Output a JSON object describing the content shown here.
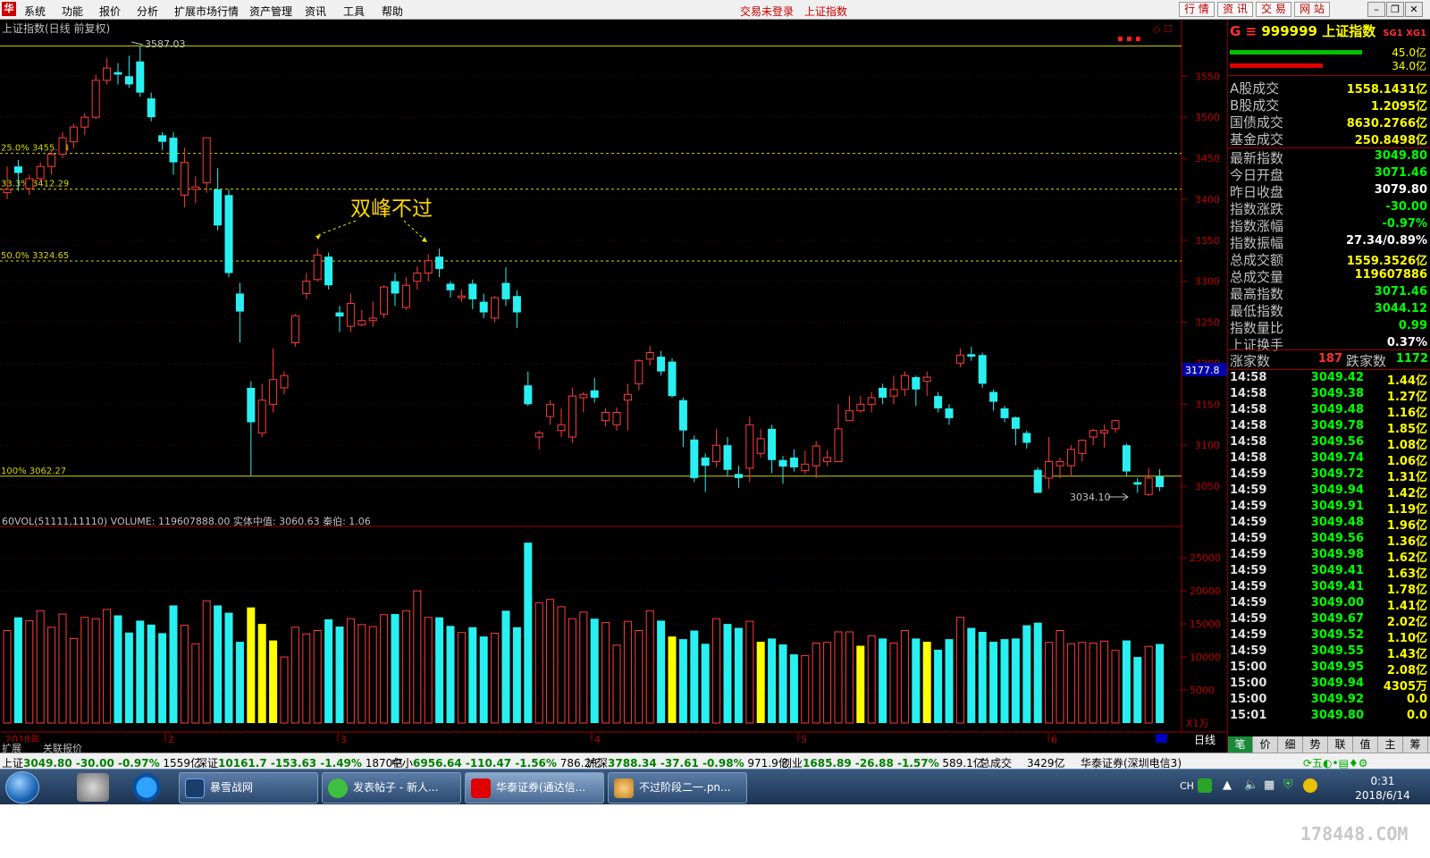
{
  "menu": {
    "items": [
      "系统",
      "功能",
      "报价",
      "分析",
      "扩展市场行情",
      "资产管理",
      "资讯",
      "工具",
      "帮助"
    ],
    "status_notice": "交易未登录",
    "status_index": "上证指数",
    "quick_buttons": [
      "行 情",
      "资 讯",
      "交 易",
      "网 站"
    ]
  },
  "chart": {
    "title": "上证指数(日线 前复权)",
    "annotation": "双峰不过",
    "high_label": "3587.03",
    "low_label": "3034.10",
    "crosshair_price": "3177.8",
    "volume_header": "60VOL(51111,11110)  VOLUME: 119607888.00  实体中值: 3060.63  秦伯: 1.06",
    "volume_unit": "X1万",
    "fib_levels": [
      {
        "label": "25.0% 3455.84",
        "price": 3455.84
      },
      {
        "label": "33.3% 3412.29",
        "price": 3412.29
      },
      {
        "label": "50.0% 3324.65",
        "price": 3324.65
      },
      {
        "label": "100% 3062.27",
        "price": 3062.27
      }
    ],
    "top_line_price": 3587.03,
    "date_labels": [
      "2018年",
      "2",
      "3",
      "4",
      "5",
      "6"
    ],
    "period_label": "日线",
    "bottom_tabs": [
      "扩展　　",
      "关联报价"
    ]
  },
  "chart_data": {
    "type": "candlestick",
    "price_axis": {
      "ticks": [
        3050,
        3100,
        3150,
        3200,
        3250,
        3300,
        3350,
        3400,
        3450,
        3500,
        3550
      ],
      "range": [
        3025,
        3595
      ]
    },
    "volume_axis": {
      "ticks": [
        5000,
        10000,
        15000,
        20000,
        25000
      ],
      "range": [
        0,
        28000
      ],
      "unit": "万"
    },
    "candles": [
      [
        3412,
        3408,
        3440,
        3400,
        "u",
        14000
      ],
      [
        3440,
        3432,
        3448,
        3410,
        "d",
        16000
      ],
      [
        3413,
        3425,
        3430,
        3405,
        "u",
        15500
      ],
      [
        3425,
        3440,
        3445,
        3420,
        "u",
        17000
      ],
      [
        3440,
        3455,
        3460,
        3430,
        "u",
        14500
      ],
      [
        3455,
        3475,
        3482,
        3450,
        "u",
        16500
      ],
      [
        3470,
        3488,
        3492,
        3462,
        "u",
        12800
      ],
      [
        3488,
        3500,
        3505,
        3478,
        "u",
        16000
      ],
      [
        3500,
        3545,
        3552,
        3498,
        "u",
        15800
      ],
      [
        3545,
        3560,
        3572,
        3540,
        "u",
        17200
      ],
      [
        3555,
        3552,
        3566,
        3540,
        "d",
        16300
      ],
      [
        3540,
        3550,
        3575,
        3536,
        "d",
        13700
      ],
      [
        3568,
        3530,
        3587,
        3525,
        "d",
        15500
      ],
      [
        3523,
        3500,
        3530,
        3495,
        "d",
        14900
      ],
      [
        3478,
        3470,
        3482,
        3460,
        "d",
        13600
      ],
      [
        3475,
        3445,
        3482,
        3430,
        "d",
        17800
      ],
      [
        3405,
        3445,
        3463,
        3390,
        "u",
        14800
      ],
      [
        3415,
        3412,
        3428,
        3395,
        "u",
        12000
      ],
      [
        3420,
        3475,
        3475,
        3408,
        "u",
        18500
      ],
      [
        3412,
        3368,
        3438,
        3362,
        "d",
        17800
      ],
      [
        3405,
        3310,
        3412,
        3305,
        "d",
        16700
      ],
      [
        3285,
        3263,
        3298,
        3225,
        "d",
        12300
      ],
      [
        3170,
        3128,
        3178,
        3063,
        "d",
        17500
      ],
      [
        3115,
        3155,
        3175,
        3110,
        "u",
        15000
      ],
      [
        3150,
        3180,
        3218,
        3140,
        "u",
        12500
      ],
      [
        3170,
        3185,
        3190,
        3162,
        "u",
        10000
      ],
      [
        3225,
        3258,
        3260,
        3220,
        "u",
        14500
      ],
      [
        3285,
        3300,
        3310,
        3278,
        "u",
        13500
      ],
      [
        3302,
        3332,
        3340,
        3300,
        "u",
        14000
      ],
      [
        3330,
        3295,
        3335,
        3290,
        "d",
        15700
      ],
      [
        3262,
        3257,
        3270,
        3238,
        "d",
        14600
      ],
      [
        3245,
        3273,
        3285,
        3238,
        "u",
        15800
      ],
      [
        3247,
        3252,
        3265,
        3245,
        "u",
        14900
      ],
      [
        3252,
        3255,
        3275,
        3244,
        "u",
        14600
      ],
      [
        3260,
        3293,
        3295,
        3255,
        "u",
        16400
      ],
      [
        3300,
        3285,
        3310,
        3270,
        "d",
        16500
      ],
      [
        3268,
        3295,
        3305,
        3265,
        "u",
        17000
      ],
      [
        3300,
        3310,
        3318,
        3290,
        "u",
        20000
      ],
      [
        3310,
        3325,
        3333,
        3300,
        "u",
        16000
      ],
      [
        3330,
        3315,
        3340,
        3305,
        "d",
        16000
      ],
      [
        3297,
        3289,
        3300,
        3280,
        "d",
        14700
      ],
      [
        3280,
        3282,
        3290,
        3275,
        "u",
        13700
      ],
      [
        3297,
        3278,
        3302,
        3266,
        "d",
        14500
      ],
      [
        3275,
        3262,
        3285,
        3255,
        "d",
        13100
      ],
      [
        3255,
        3280,
        3282,
        3250,
        "u",
        13600
      ],
      [
        3298,
        3278,
        3317,
        3270,
        "d",
        17000
      ],
      [
        3282,
        3262,
        3289,
        3243,
        "d",
        14500
      ],
      [
        3173,
        3150,
        3190,
        3148,
        "d",
        27300
      ],
      [
        3110,
        3115,
        3118,
        3095,
        "u",
        18200
      ],
      [
        3135,
        3150,
        3155,
        3125,
        "u",
        18700
      ],
      [
        3125,
        3118,
        3145,
        3110,
        "u",
        17600
      ],
      [
        3110,
        3160,
        3170,
        3103,
        "u",
        15800
      ],
      [
        3158,
        3162,
        3165,
        3140,
        "u",
        16800
      ],
      [
        3167,
        3158,
        3182,
        3152,
        "d",
        15800
      ],
      [
        3130,
        3140,
        3145,
        3123,
        "u",
        15200
      ],
      [
        3125,
        3140,
        3146,
        3118,
        "u",
        11800
      ],
      [
        3155,
        3162,
        3175,
        3118,
        "u",
        15400
      ],
      [
        3175,
        3203,
        3205,
        3167,
        "u",
        14000
      ],
      [
        3205,
        3213,
        3221,
        3197,
        "u",
        17000
      ],
      [
        3208,
        3190,
        3215,
        3185,
        "d",
        15500
      ],
      [
        3202,
        3160,
        3206,
        3158,
        "d",
        13100
      ],
      [
        3155,
        3118,
        3158,
        3098,
        "d",
        12700
      ],
      [
        3107,
        3060,
        3112,
        3055,
        "d",
        14000
      ],
      [
        3085,
        3075,
        3090,
        3043,
        "d",
        12000
      ],
      [
        3080,
        3100,
        3120,
        3073,
        "u",
        15800
      ],
      [
        3100,
        3070,
        3110,
        3062,
        "d",
        15000
      ],
      [
        3065,
        3060,
        3075,
        3048,
        "d",
        14400
      ],
      [
        3072,
        3125,
        3135,
        3055,
        "u",
        15400
      ],
      [
        3090,
        3108,
        3120,
        3085,
        "u",
        12300
      ],
      [
        3120,
        3082,
        3125,
        3066,
        "d",
        12800
      ],
      [
        3082,
        3074,
        3087,
        3053,
        "d",
        11900
      ],
      [
        3085,
        3073,
        3095,
        3068,
        "d",
        10400
      ],
      [
        3069,
        3077,
        3093,
        3065,
        "u",
        10200
      ],
      [
        3075,
        3099,
        3105,
        3060,
        "u",
        12100
      ],
      [
        3080,
        3085,
        3094,
        3075,
        "u",
        12200
      ],
      [
        3080,
        3120,
        3150,
        3080,
        "u",
        13800
      ],
      [
        3130,
        3142,
        3160,
        3130,
        "u",
        13800
      ],
      [
        3142,
        3150,
        3160,
        3140,
        "u",
        11700
      ],
      [
        3150,
        3158,
        3165,
        3140,
        "u",
        13200
      ],
      [
        3170,
        3158,
        3175,
        3150,
        "d",
        12800
      ],
      [
        3160,
        3168,
        3185,
        3150,
        "u",
        12100
      ],
      [
        3168,
        3185,
        3190,
        3160,
        "u",
        14000
      ],
      [
        3183,
        3168,
        3185,
        3148,
        "d",
        12800
      ],
      [
        3178,
        3183,
        3190,
        3160,
        "u",
        12300
      ],
      [
        3160,
        3145,
        3165,
        3140,
        "d",
        11100
      ],
      [
        3145,
        3133,
        3150,
        3125,
        "d",
        12700
      ],
      [
        3200,
        3210,
        3218,
        3195,
        "u",
        16000
      ],
      [
        3211,
        3208,
        3220,
        3203,
        "d",
        14400
      ],
      [
        3210,
        3175,
        3213,
        3170,
        "d",
        13800
      ],
      [
        3165,
        3153,
        3168,
        3142,
        "d",
        12300
      ],
      [
        3145,
        3133,
        3148,
        3128,
        "d",
        12700
      ],
      [
        3134,
        3120,
        3135,
        3100,
        "d",
        12800
      ],
      [
        3115,
        3103,
        3118,
        3096,
        "d",
        14800
      ],
      [
        3070,
        3042,
        3073,
        3042,
        "d",
        15200
      ],
      [
        3060,
        3080,
        3110,
        3047,
        "u",
        12200
      ],
      [
        3075,
        3080,
        3085,
        3060,
        "u",
        14000
      ],
      [
        3075,
        3095,
        3100,
        3062,
        "u",
        12000
      ],
      [
        3090,
        3106,
        3107,
        3080,
        "u",
        12200
      ],
      [
        3110,
        3118,
        3120,
        3100,
        "u",
        12100
      ],
      [
        3115,
        3118,
        3125,
        3097,
        "u",
        12400
      ],
      [
        3120,
        3130,
        3131,
        3115,
        "u",
        11000
      ],
      [
        3100,
        3068,
        3102,
        3062,
        "d",
        12500
      ],
      [
        3055,
        3052,
        3060,
        3042,
        "d",
        10000
      ],
      [
        3040,
        3060,
        3072,
        3038,
        "u",
        11600
      ],
      [
        3062,
        3049,
        3071,
        3044,
        "d",
        11961
      ]
    ],
    "yellow_volume_bars": [
      22,
      23,
      24,
      60,
      68,
      77,
      83
    ]
  },
  "right_panel": {
    "code": "999999",
    "name": "上证指数",
    "tag": "SG1 XG1",
    "bar_values": [
      "45.0亿",
      "34.0亿"
    ],
    "bar_ratio": [
      0.82,
      0.58
    ],
    "stats_a": [
      {
        "label": "A股成交",
        "value": "1558.1431亿"
      },
      {
        "label": "B股成交",
        "value": "1.2095亿"
      },
      {
        "label": "国债成交",
        "value": "8630.2766亿"
      },
      {
        "label": "基金成交",
        "value": "250.8498亿"
      }
    ],
    "stats_b": [
      {
        "label": "最新指数",
        "value": "3049.80",
        "color": "#00ff00"
      },
      {
        "label": "今日开盘",
        "value": "3071.46",
        "color": "#00ff00"
      },
      {
        "label": "昨日收盘",
        "value": "3079.80",
        "color": "#ffffff"
      },
      {
        "label": "指数涨跌",
        "value": "-30.00",
        "color": "#00ff00"
      },
      {
        "label": "指数涨幅",
        "value": "-0.97%",
        "color": "#00ff00"
      },
      {
        "label": "指数振幅",
        "value": "27.34/0.89%",
        "color": "#ffffff"
      },
      {
        "label": "总成交额",
        "value": "1559.3526亿",
        "color": "#ffff00"
      },
      {
        "label": "总成交量",
        "value": "119607886",
        "color": "#ffff00"
      },
      {
        "label": "最高指数",
        "value": "3071.46",
        "color": "#00ff00"
      },
      {
        "label": "最低指数",
        "value": "3044.12",
        "color": "#00ff00"
      },
      {
        "label": "指数量比",
        "value": "0.99",
        "color": "#00ff00"
      },
      {
        "label": "上证换手",
        "value": "0.37%",
        "color": "#ffffff"
      }
    ],
    "up_label": "涨家数",
    "up_count": "187",
    "down_label": "跌家数",
    "down_count": "1172",
    "trades": [
      [
        "14:58",
        "3049.42",
        "1.44亿"
      ],
      [
        "14:58",
        "3049.38",
        "1.27亿"
      ],
      [
        "14:58",
        "3049.48",
        "1.16亿"
      ],
      [
        "14:58",
        "3049.78",
        "1.85亿"
      ],
      [
        "14:58",
        "3049.56",
        "1.08亿"
      ],
      [
        "14:58",
        "3049.74",
        "1.06亿"
      ],
      [
        "14:59",
        "3049.72",
        "1.31亿"
      ],
      [
        "14:59",
        "3049.94",
        "1.42亿"
      ],
      [
        "14:59",
        "3049.91",
        "1.19亿"
      ],
      [
        "14:59",
        "3049.48",
        "1.96亿"
      ],
      [
        "14:59",
        "3049.56",
        "1.36亿"
      ],
      [
        "14:59",
        "3049.98",
        "1.62亿"
      ],
      [
        "14:59",
        "3049.41",
        "1.63亿"
      ],
      [
        "14:59",
        "3049.41",
        "1.78亿"
      ],
      [
        "14:59",
        "3049.00",
        "1.41亿"
      ],
      [
        "14:59",
        "3049.67",
        "2.02亿"
      ],
      [
        "14:59",
        "3049.52",
        "1.10亿"
      ],
      [
        "14:59",
        "3049.55",
        "1.43亿"
      ],
      [
        "15:00",
        "3049.95",
        "2.08亿"
      ],
      [
        "15:00",
        "3049.94",
        "4305万"
      ],
      [
        "15:00",
        "3049.92",
        "0.0"
      ],
      [
        "15:01",
        "3049.80",
        "0.0"
      ]
    ],
    "tabs": [
      "笔",
      "价",
      "细",
      "势",
      "联",
      "值",
      "主",
      "筹"
    ]
  },
  "bottom_bar": {
    "segments": [
      {
        "name": "上证",
        "value": "3049.80",
        "change": "-30.00",
        "pct": "-0.97%",
        "amount": "1559亿"
      },
      {
        "name": "深证",
        "value": "10161.7",
        "change": "-153.63",
        "pct": "-1.49%",
        "amount": "1870亿"
      },
      {
        "name": "中小",
        "value": "6956.64",
        "change": "-110.47",
        "pct": "-1.56%",
        "amount": "786.2亿"
      },
      {
        "name": "沪深",
        "value": "3788.34",
        "change": "-37.61",
        "pct": "-0.98%",
        "amount": "971.9亿"
      },
      {
        "name": "创业",
        "value": "1685.89",
        "change": "-26.88",
        "pct": "-1.57%",
        "amount": "589.1亿"
      }
    ],
    "total_label": "总成交",
    "total_value": "3429亿",
    "broker": "华泰证券(深圳电信3)"
  },
  "taskbar": {
    "tasks": [
      "暴雪战网",
      "发表帖子 - 新人...",
      "华泰证券(通达信...",
      "不过阶段二一.pn..."
    ],
    "ime": "CH",
    "time": "0:31",
    "date": "2018/6/14"
  },
  "watermark": "178448.COM"
}
